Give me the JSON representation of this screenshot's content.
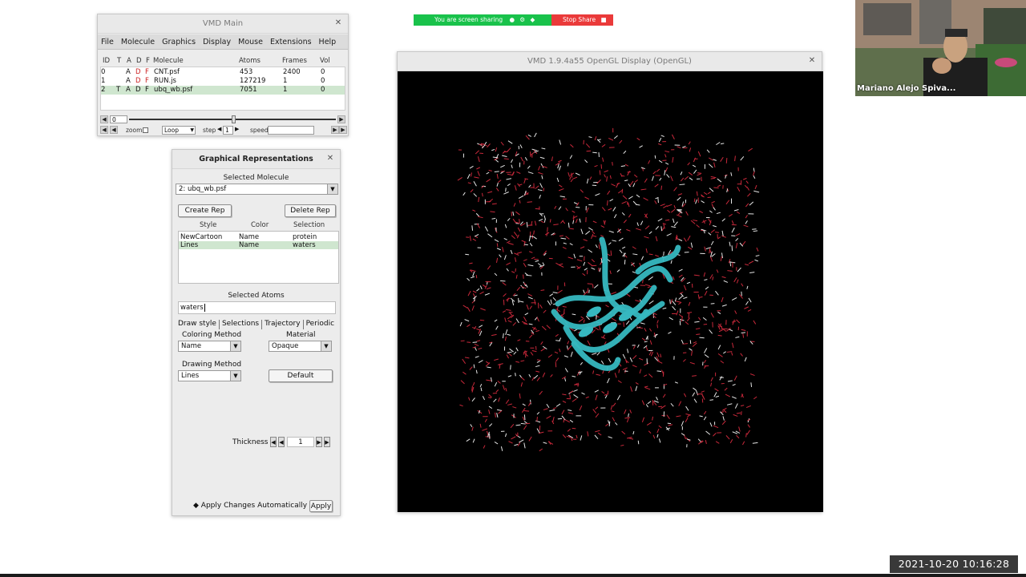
{
  "share_bar": {
    "status": "You are screen sharing",
    "stop_label": "Stop Share"
  },
  "webcam": {
    "participant_name": "Mariano Alejo Spiva..."
  },
  "timestamp": "2021-10-20  10:16:28",
  "vmd_main": {
    "title": "VMD Main",
    "menus": [
      "File",
      "Molecule",
      "Graphics",
      "Display",
      "Mouse",
      "Extensions",
      "Help"
    ],
    "columns": {
      "id": "ID",
      "t": "T",
      "a": "A",
      "d": "D",
      "f": "F",
      "molecule": "Molecule",
      "atoms": "Atoms",
      "frames": "Frames",
      "vol": "Vol"
    },
    "molecules": [
      {
        "id": "0",
        "t": "",
        "a": "A",
        "d": "D",
        "f": "F",
        "name": "CNT.psf",
        "atoms": "453",
        "frames": "2400",
        "vol": "0"
      },
      {
        "id": "1",
        "t": "",
        "a": "A",
        "d": "D",
        "f": "F",
        "name": "RUN.js",
        "atoms": "127219",
        "frames": "1",
        "vol": "0"
      },
      {
        "id": "2",
        "t": "T",
        "a": "A",
        "d": "D",
        "f": "F",
        "name": "ubq_wb.psf",
        "atoms": "7051",
        "frames": "1",
        "vol": "0"
      }
    ],
    "frame_value": "0",
    "zoom_label": "zoom",
    "loop_value": "Loop",
    "step_label": "step",
    "step_value": "1",
    "speed_label": "speed"
  },
  "graphical_reps": {
    "title": "Graphical Representations",
    "selected_molecule_label": "Selected Molecule",
    "selected_molecule_value": "2: ubq_wb.psf",
    "create_rep_label": "Create Rep",
    "delete_rep_label": "Delete Rep",
    "columns": {
      "style": "Style",
      "color": "Color",
      "selection": "Selection"
    },
    "reps": [
      {
        "style": "NewCartoon",
        "color": "Name",
        "selection": "protein"
      },
      {
        "style": "Lines",
        "color": "Name",
        "selection": "waters"
      }
    ],
    "selected_atoms_label": "Selected Atoms",
    "selected_atoms_value": "waters",
    "tabs": [
      "Draw style",
      "Selections",
      "Trajectory",
      "Periodic"
    ],
    "coloring_method_label": "Coloring Method",
    "coloring_method_value": "Name",
    "material_label": "Material",
    "material_value": "Opaque",
    "drawing_method_label": "Drawing Method",
    "drawing_method_value": "Lines",
    "default_label": "Default",
    "thickness_label": "Thickness",
    "thickness_value": "1",
    "apply_auto_label": "Apply Changes Automatically",
    "apply_label": "Apply"
  },
  "gl_display": {
    "title": "VMD 1.9.4a55 OpenGL Display (OpenGL)"
  },
  "colors": {
    "water_red": "#c8283a",
    "water_white": "#e6e6e6",
    "protein_cyan": "#36b8c0",
    "share_green": "#19c24b",
    "share_red": "#ea3a3a",
    "selection_green": "#cfe6cf"
  }
}
